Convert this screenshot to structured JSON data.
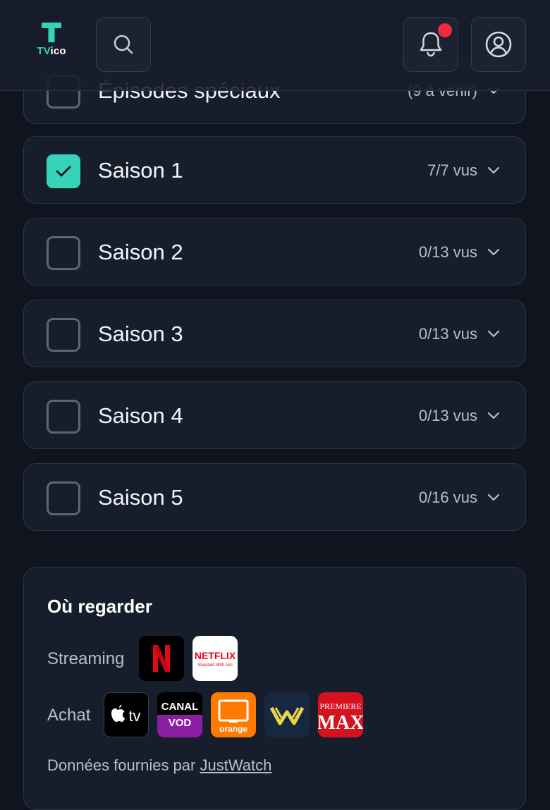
{
  "header": {
    "logo_prefix": "TV",
    "logo_suffix": "ico",
    "notification_badge_color": "#ef2b3d"
  },
  "seasons": [
    {
      "label": "Épisodes spéciaux",
      "count": "(9 à venir)",
      "checked": false
    },
    {
      "label": "Saison 1",
      "count": "7/7 vus",
      "checked": true
    },
    {
      "label": "Saison 2",
      "count": "0/13 vus",
      "checked": false
    },
    {
      "label": "Saison 3",
      "count": "0/13 vus",
      "checked": false
    },
    {
      "label": "Saison 4",
      "count": "0/13 vus",
      "checked": false
    },
    {
      "label": "Saison 5",
      "count": "0/16 vus",
      "checked": false
    }
  ],
  "where_to_watch": {
    "title": "Où regarder",
    "streaming_label": "Streaming",
    "streaming_providers": [
      {
        "name": "Netflix",
        "icon": "netflix-n-logo"
      },
      {
        "name": "Netflix Standard With Ads",
        "icon": "netflix-ads-logo"
      }
    ],
    "purchase_label": "Achat",
    "purchase_providers": [
      {
        "name": "Apple TV",
        "icon": "apple-tv-logo"
      },
      {
        "name": "Canal VOD",
        "icon": "canal-vod-logo"
      },
      {
        "name": "Orange",
        "icon": "orange-logo"
      },
      {
        "name": "Wuaki",
        "icon": "w-logo"
      },
      {
        "name": "Premiere Max",
        "icon": "premiere-max-logo"
      }
    ],
    "footer_text": "Données fournies par",
    "footer_link": "JustWatch"
  },
  "colors": {
    "accent": "#35d4b8",
    "background": "#0f141f",
    "card": "#171e2b"
  }
}
